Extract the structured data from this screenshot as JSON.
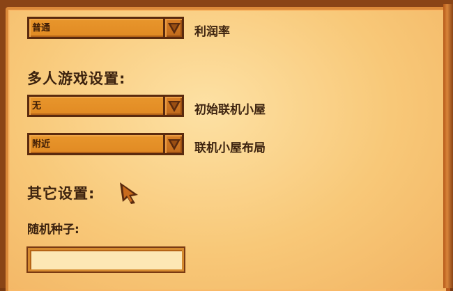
{
  "misc_top": {
    "profit_dropdown_value": "普通",
    "profit_label": "利润率"
  },
  "multiplayer": {
    "section_title": "多人游戏设置:",
    "starting_cabins_value": "无",
    "starting_cabins_label": "初始联机小屋",
    "cabin_layout_value": "附近",
    "cabin_layout_label": "联机小屋布局"
  },
  "other": {
    "section_title": "其它设置:",
    "seed_label": "随机种子:",
    "seed_value": ""
  },
  "icons": {
    "dropdown_arrow": "triangle-down-icon",
    "cursor": "pointer-cursor-icon"
  },
  "colors": {
    "panel_bg": "#f8c878",
    "dropdown_fill": "#e18a23",
    "dark_outline": "#5a2a0e",
    "text": "#3d230f"
  }
}
